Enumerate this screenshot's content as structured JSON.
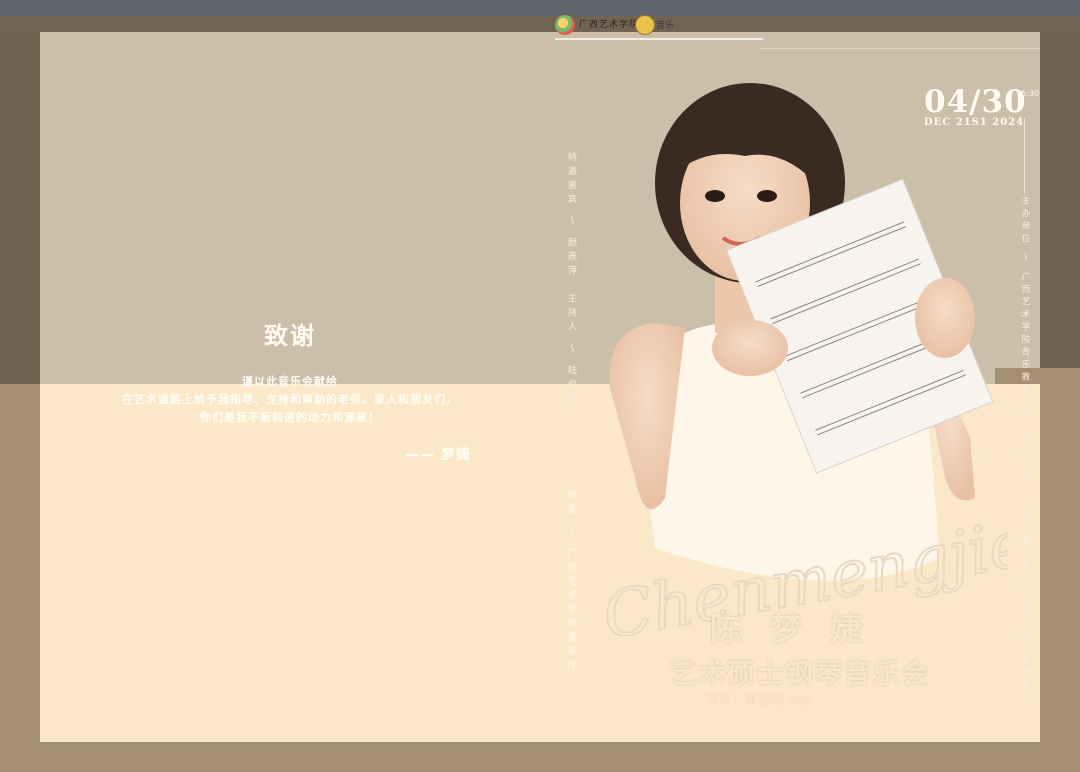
{
  "logos": {
    "school_text": "广西艺术学院",
    "partner_text": "音乐"
  },
  "left_page": {
    "title": "致谢",
    "lines": [
      "谨以此音乐会献给",
      "在艺术道路上给予我指导、支持和帮助的老师、家人和朋友们，",
      "你们是我不断前进的动力和源泉！"
    ],
    "signature": "—— 梦婕"
  },
  "credits": {
    "left_column_top": "特邀嘉宾 ～ 颜燕萍　主持人 ～ 陆俊帆",
    "left_column_bottom": "地址 ～ 广西艺术学院音乐厅",
    "right_column": "主办单位 ～ 广西艺术学院音乐教育学院　承办单位 ～ 音乐教育学院钢琴系 研究生教学部"
  },
  "date": {
    "big": "04/30",
    "time": "15:30",
    "sub": "DEC  21S1 2024"
  },
  "performer": {
    "script_name": "Chenmengjie",
    "name_cn": "陈梦婕",
    "concert_title": "艺术硕士钢琴音乐会",
    "mentor": "导师：崔静瑶",
    "mentor_suffix": "副教授"
  },
  "colors": {
    "outer_frame": "#a48f73",
    "paper_top": "#cbbfaa",
    "paper_bottom": "#fbe8c8",
    "title_gold": "#f6e7c8"
  }
}
